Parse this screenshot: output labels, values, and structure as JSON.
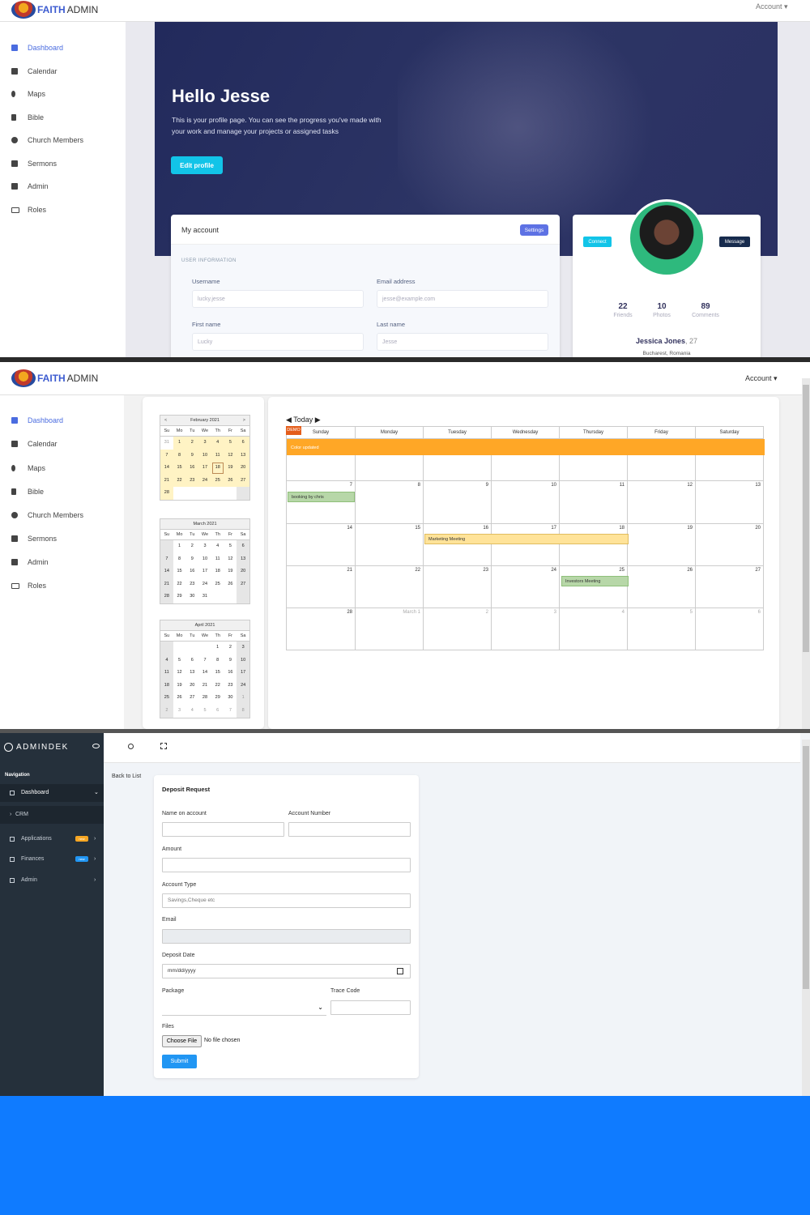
{
  "faith": {
    "brand_bold": "FAITH",
    "brand_rest": "ADMIN",
    "account": "Account ▾",
    "nav": [
      "Dashboard",
      "Calendar",
      "Maps",
      "Bible",
      "Church Members",
      "Sermons",
      "Admin",
      "Roles"
    ],
    "hero": {
      "greeting": "Hello Jesse",
      "text": "This is your profile page. You can see the progress you've made with your work and manage your projects or assigned tasks",
      "edit": "Edit profile"
    },
    "my_account": {
      "title": "My account",
      "settings": "Settings",
      "section": "USER INFORMATION",
      "username_label": "Username",
      "username": "lucky.jesse",
      "email_label": "Email address",
      "email": "jesse@example.com",
      "first_label": "First name",
      "first": "Lucky",
      "last_label": "Last name",
      "last": "Jesse"
    },
    "profile": {
      "connect": "Connect",
      "message": "Message",
      "friends": "22",
      "friends_label": "Friends",
      "photos": "10",
      "photos_label": "Photos",
      "comments": "89",
      "comments_label": "Comments",
      "name": "Jessica Jones",
      "age": ", 27",
      "location": "Bucharest, Romania"
    }
  },
  "calendar": {
    "today": "◀ Today ▶",
    "demo": "DEMO",
    "days": [
      "Sunday",
      "Monday",
      "Tuesday",
      "Wednesday",
      "Thursday",
      "Friday",
      "Saturday"
    ],
    "weeks": [
      [
        "31",
        "February 1",
        "2",
        "3",
        "4",
        "5",
        "6"
      ],
      [
        "7",
        "8",
        "9",
        "10",
        "11",
        "12",
        "13"
      ],
      [
        "14",
        "15",
        "16",
        "17",
        "18",
        "19",
        "20"
      ],
      [
        "21",
        "22",
        "23",
        "24",
        "25",
        "26",
        "27"
      ],
      [
        "28",
        "March 1",
        "2",
        "3",
        "4",
        "5",
        "6"
      ]
    ],
    "events": {
      "color_updated": "Color updated",
      "booking": "booking by chris",
      "marketing": "Marketing Meeting",
      "investors": "Investors Meeting"
    },
    "mini_days": [
      "Su",
      "Mo",
      "Tu",
      "We",
      "Th",
      "Fr",
      "Sa"
    ],
    "mini": [
      {
        "title": "February 2021",
        "prev": "<",
        "next": ">",
        "cells": [
          "31",
          "1",
          "2",
          "3",
          "4",
          "5",
          "6",
          "7",
          "8",
          "9",
          "10",
          "11",
          "12",
          "13",
          "14",
          "15",
          "16",
          "17",
          "18",
          "19",
          "20",
          "21",
          "22",
          "23",
          "24",
          "25",
          "26",
          "27",
          "28",
          "",
          "",
          "",
          "",
          "",
          ""
        ]
      },
      {
        "title": "March 2021",
        "cells": [
          "",
          "1",
          "2",
          "3",
          "4",
          "5",
          "6",
          "7",
          "8",
          "9",
          "10",
          "11",
          "12",
          "13",
          "14",
          "15",
          "16",
          "17",
          "18",
          "19",
          "20",
          "21",
          "22",
          "23",
          "24",
          "25",
          "26",
          "27",
          "28",
          "29",
          "30",
          "31",
          "",
          "",
          ""
        ]
      },
      {
        "title": "April 2021",
        "cells": [
          "",
          "",
          "",
          "",
          "1",
          "2",
          "3",
          "4",
          "5",
          "6",
          "7",
          "8",
          "9",
          "10",
          "11",
          "12",
          "13",
          "14",
          "15",
          "16",
          "17",
          "18",
          "19",
          "20",
          "21",
          "22",
          "23",
          "24",
          "25",
          "26",
          "27",
          "28",
          "29",
          "30",
          "1",
          "2",
          "3",
          "4",
          "5",
          "6",
          "7",
          "8"
        ]
      }
    ]
  },
  "adminek": {
    "brand": "ADMINDEK",
    "nav_label": "Navigation",
    "items": [
      {
        "label": "Dashboard",
        "chevron": "⌄"
      },
      {
        "label": "CRM"
      },
      {
        "label": "Applications",
        "badge": "new",
        "chevron": "›"
      },
      {
        "label": "Finances",
        "badge": "new",
        "chevron": "›"
      },
      {
        "label": "Admin",
        "chevron": "›"
      }
    ],
    "badge_colors": [
      "#f6a623",
      "#2196f3"
    ],
    "back": "Back to List",
    "form": {
      "title": "Deposit Request",
      "name_label": "Name on account",
      "number_label": "Account Number",
      "amount_label": "Amount",
      "type_label": "Account Type",
      "type_placeholder": "Savings,Cheque etc",
      "email_label": "Email",
      "date_label": "Deposit Date",
      "date_placeholder": "mm/dd/yyyy",
      "package_label": "Package",
      "trace_label": "Trace Code",
      "files_label": "Files",
      "choose": "Choose File",
      "no_file": "No file chosen",
      "submit": "Submit"
    }
  },
  "colors": {
    "accent_faith": "#4a6ce0",
    "hero": "#2a3163",
    "event_orange": "#ffa726",
    "adminek_side": "#25303b",
    "bottom": "#0f7bff"
  }
}
